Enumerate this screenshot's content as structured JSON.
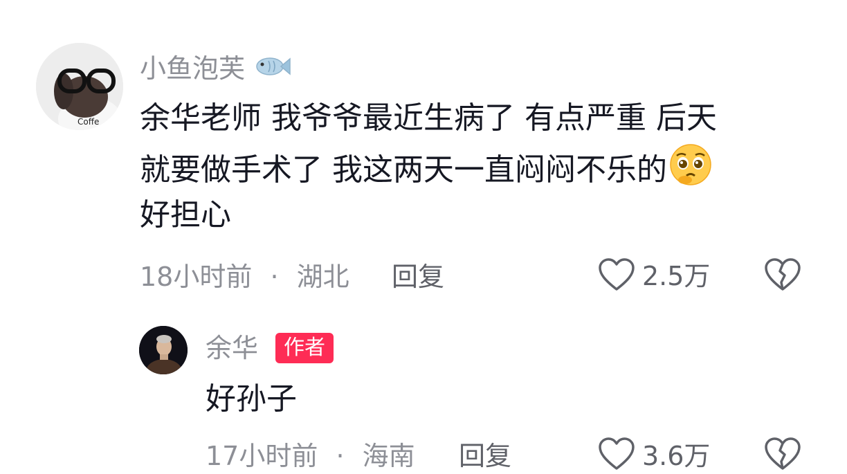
{
  "comments": [
    {
      "username": "小鱼泡芙",
      "username_icon": "fish-emoji",
      "text_lines": [
        "余华老师 我爷爷最近生病了 有点严重 后天",
        "就要做手术了 我这两天一直闷闷不乐的",
        "好担心"
      ],
      "text_emoji": "pleading-face-emoji",
      "time": "18小时前",
      "dot": "·",
      "location": "湖北",
      "reply_label": "回复",
      "likes": "2.5万"
    },
    {
      "username": "余华",
      "badge": "作者",
      "text": "好孙子",
      "time": "17小时前",
      "dot": "·",
      "location": "海南",
      "reply_label": "回复",
      "likes": "3.6万"
    }
  ],
  "colors": {
    "primary_text": "#161823",
    "secondary_text": "#8d8f96",
    "author_badge": "#fe2c55",
    "background": "#ffffff"
  }
}
